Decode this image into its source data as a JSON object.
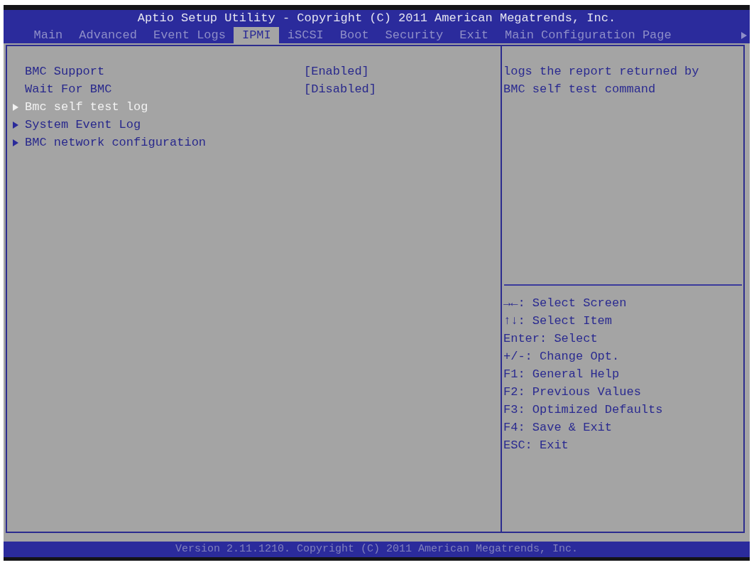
{
  "header": {
    "title": "Aptio Setup Utility - Copyright (C) 2011 American Megatrends, Inc."
  },
  "tabs": [
    {
      "label": "Main",
      "selected": false
    },
    {
      "label": "Advanced",
      "selected": false
    },
    {
      "label": "Event Logs",
      "selected": false
    },
    {
      "label": "IPMI",
      "selected": true
    },
    {
      "label": "iSCSI",
      "selected": false
    },
    {
      "label": "Boot",
      "selected": false
    },
    {
      "label": "Security",
      "selected": false
    },
    {
      "label": "Exit",
      "selected": false
    },
    {
      "label": "Main Configuration Page",
      "selected": false
    }
  ],
  "settings": [
    {
      "kind": "option",
      "label": "BMC Support",
      "value": "[Enabled]",
      "selected": false
    },
    {
      "kind": "option",
      "label": "Wait For BMC",
      "value": "[Disabled]",
      "selected": false
    },
    {
      "kind": "submenu",
      "label": "Bmc self test log",
      "selected": true
    },
    {
      "kind": "submenu",
      "label": "System Event Log",
      "selected": false
    },
    {
      "kind": "submenu",
      "label": "BMC network configuration",
      "selected": false
    }
  ],
  "help": {
    "description": "logs the report returned by BMC self test command",
    "key_hints": [
      "→←: Select Screen",
      "↑↓: Select Item",
      "Enter: Select",
      "+/-: Change Opt.",
      "F1: General Help",
      "F2: Previous Values",
      "F3: Optimized Defaults",
      "F4: Save & Exit",
      "ESC: Exit"
    ]
  },
  "footer": {
    "text": "Version 2.11.1210. Copyright (C) 2011 American Megatrends, Inc."
  }
}
